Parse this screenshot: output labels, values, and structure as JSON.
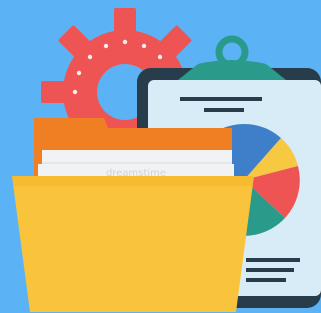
{
  "illustration": {
    "watermark": "dreamstime",
    "icons": [
      "gear-icon",
      "clipboard-icon",
      "pie-chart-icon",
      "folder-icon",
      "documents-icon"
    ]
  },
  "colors": {
    "background": "#5bb3f5",
    "gear": "#ef5454",
    "gear_hole": "#5bb3f5",
    "clipboard_frame": "#273d4c",
    "clipboard_paper": "#d8ecf8",
    "clip": "#2a9b8a",
    "pie_red": "#ef5454",
    "pie_yellow": "#f7c842",
    "pie_teal": "#2a9b8a",
    "pie_blue": "#3f7fc9",
    "folder_back": "#f07e23",
    "folder_front": "#f9c33b",
    "paper": "#f1f2f4"
  }
}
